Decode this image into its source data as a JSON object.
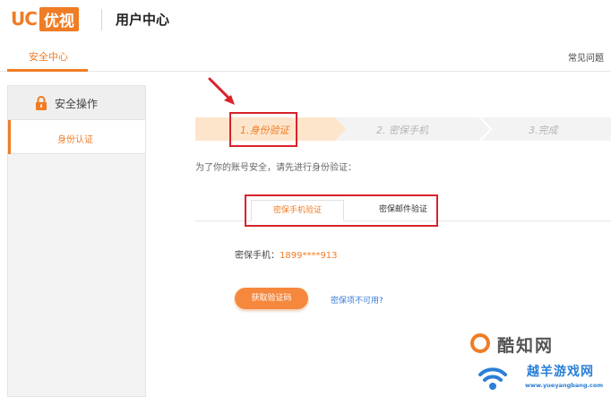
{
  "header": {
    "logo_uc": "UC",
    "logo_youshi": "优视",
    "title": "用户中心"
  },
  "nav": {
    "active_tab": "安全中心",
    "faq_link": "常见问题"
  },
  "sidebar": {
    "heading": "安全操作",
    "items": [
      {
        "label": "身份认证"
      }
    ]
  },
  "steps": [
    {
      "label": "1.身份验证"
    },
    {
      "label": "2. 密保手机"
    },
    {
      "label": "3.完成"
    }
  ],
  "instruction": "为了你的账号安全，请先进行身份验证：",
  "tabs": [
    {
      "label": "密保手机验证"
    },
    {
      "label": "密保邮件验证"
    }
  ],
  "phone": {
    "label": "密保手机：",
    "value": "1899****913"
  },
  "actions": {
    "get_code": "获取验证码",
    "unavailable": "密保项不可用?"
  },
  "watermark": {
    "brand1": "酷知网",
    "brand2": "越羊游戏网",
    "url": "www.yueyangbang.com"
  },
  "colors": {
    "accent": "#f07c24",
    "annotation_red": "#d8232a",
    "link_blue": "#3a7bd5"
  }
}
